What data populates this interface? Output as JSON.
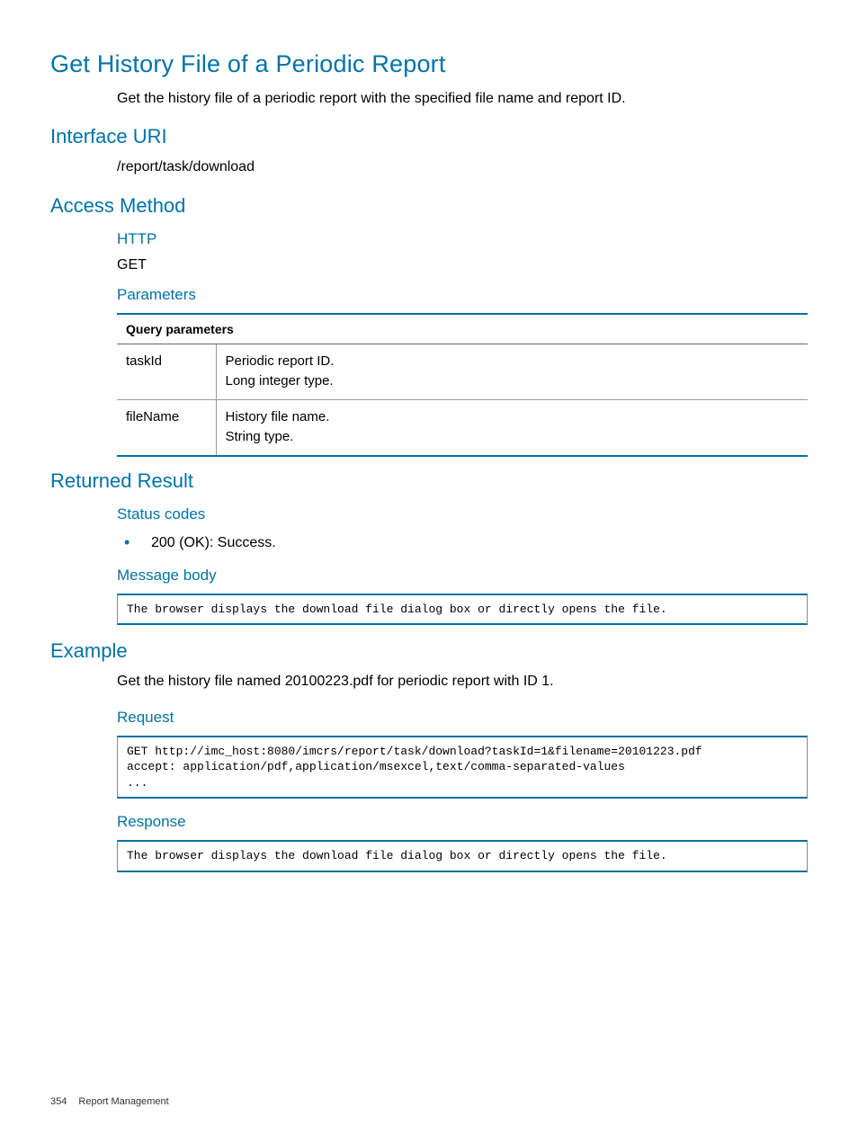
{
  "page_title": "Get History File of a Periodic Report",
  "intro": "Get the history file of a periodic report with the specified file name and report ID.",
  "sections": {
    "interface_uri": {
      "heading": "Interface URI",
      "uri": "/report/task/download"
    },
    "access_method": {
      "heading": "Access Method",
      "http_heading": "HTTP",
      "http_method": "GET",
      "parameters_heading": "Parameters",
      "table_header": "Query parameters",
      "params": [
        {
          "name": "taskId",
          "desc_line1": "Periodic report ID.",
          "desc_line2": "Long integer type."
        },
        {
          "name": "fileName",
          "desc_line1": "History file name.",
          "desc_line2": "String type."
        }
      ]
    },
    "returned_result": {
      "heading": "Returned Result",
      "status_heading": "Status codes",
      "status_items": [
        "200 (OK): Success."
      ],
      "message_body_heading": "Message body",
      "message_body_text": "The browser displays the download file dialog box or directly opens the file."
    },
    "example": {
      "heading": "Example",
      "intro": "Get the history file named 20100223.pdf for periodic report with ID 1.",
      "request_heading": "Request",
      "request_text": "GET http://imc_host:8080/imcrs/report/task/download?taskId=1&filename=20101223.pdf\naccept: application/pdf,application/msexcel,text/comma-separated-values\n...",
      "response_heading": "Response",
      "response_text": "The browser displays the download file dialog box or directly opens the file."
    }
  },
  "footer": {
    "page_number": "354",
    "section_name": "Report Management"
  }
}
